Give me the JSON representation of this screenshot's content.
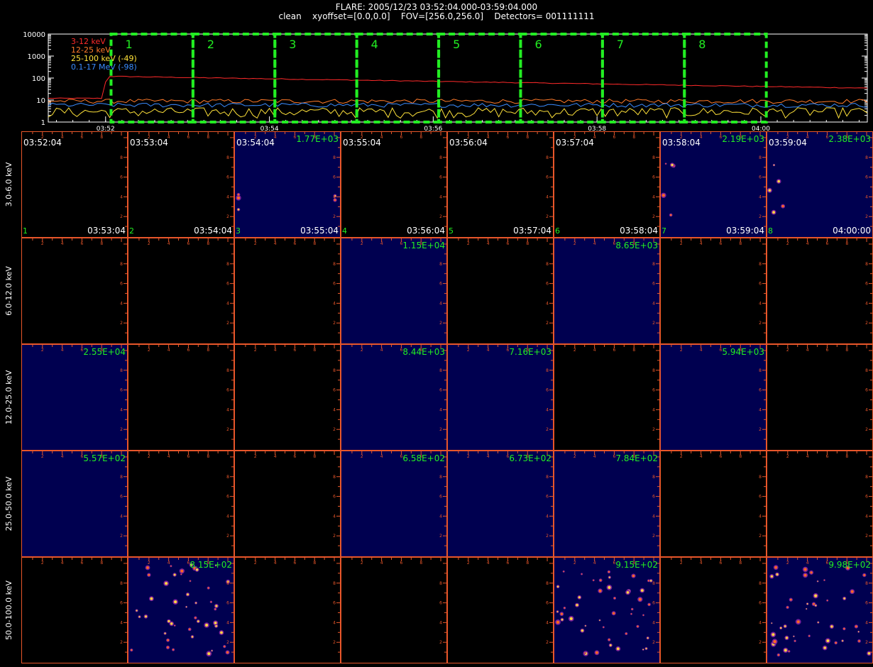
{
  "header": {
    "title": "FLARE: 2005/12/23 03:52:04.000-03:59:04.000",
    "subtitle": "clean    xyoffset=[0.0,0.0]    FOV=[256.0,256.0]    Detectors= 001111111"
  },
  "chart_data": [
    {
      "type": "line",
      "y_scale": "log",
      "ylim": [
        1,
        10000
      ],
      "y_ticks": [
        "10000",
        "1000",
        "100",
        "10",
        "1"
      ],
      "x_ticks": [
        "03:52",
        "03:54",
        "03:56",
        "03:58",
        "04:00"
      ],
      "legend_placement": "top-left",
      "series": [
        {
          "name": "3-12 keV",
          "color": "#ff2a2a",
          "level_before": 12,
          "level_peak": 120,
          "level_end": 35
        },
        {
          "name": "12-25 keV",
          "color": "#ff7a2a",
          "level": 9
        },
        {
          "name": "25-100 keV (-49)",
          "color": "#ffe23a",
          "level": 3
        },
        {
          "name": "0.1-17 MeV (-98)",
          "color": "#3a8cff",
          "level": 6
        }
      ],
      "interval_labels": [
        "1",
        "2",
        "3",
        "4",
        "5",
        "6",
        "7",
        "8"
      ],
      "interval_color": "#22ee22"
    },
    {
      "type": "heatmap",
      "row_labels": [
        "3.0-6.0 keV",
        "6.0-12.0 keV",
        "12.0-25.0 keV",
        "25.0-50.0 keV",
        "50.0-100.0 keV"
      ],
      "column_start_times": [
        "03:52:04",
        "03:53:04",
        "03:54:04",
        "03:55:04",
        "03:56:04",
        "03:57:04",
        "03:58:04",
        "03:59:04"
      ],
      "column_end_times": [
        "03:53:04",
        "03:54:04",
        "03:55:04",
        "03:56:04",
        "03:57:04",
        "03:58:04",
        "03:59:04",
        "04:00:00"
      ],
      "column_numbers": [
        "1",
        "2",
        "3",
        "4",
        "5",
        "6",
        "7",
        "8"
      ],
      "axis_ticks": [
        "2",
        "4",
        "6",
        "8",
        "10"
      ],
      "peak_values": [
        [
          "",
          "",
          "1.77E+03",
          "",
          "",
          "",
          "2.19E+03",
          "2.38E+03"
        ],
        [
          "",
          "",
          "",
          "1.15E+04",
          "",
          "8.65E+03",
          "",
          ""
        ],
        [
          "2.55E+04",
          "",
          "",
          "8.44E+03",
          "7.16E+03",
          "",
          "5.94E+03",
          ""
        ],
        [
          "5.57E+02",
          "",
          "",
          "6.58E+02",
          "6.73E+02",
          "7.84E+02",
          "",
          ""
        ],
        [
          "",
          "8.15E+02",
          "",
          "",
          "",
          "9.15E+02",
          "",
          "9.98E+02"
        ]
      ],
      "colors": {
        "axis": "#e8562a",
        "value_text": "#22ee22",
        "filled_background": "#000050",
        "empty_background": "#000000"
      }
    }
  ]
}
